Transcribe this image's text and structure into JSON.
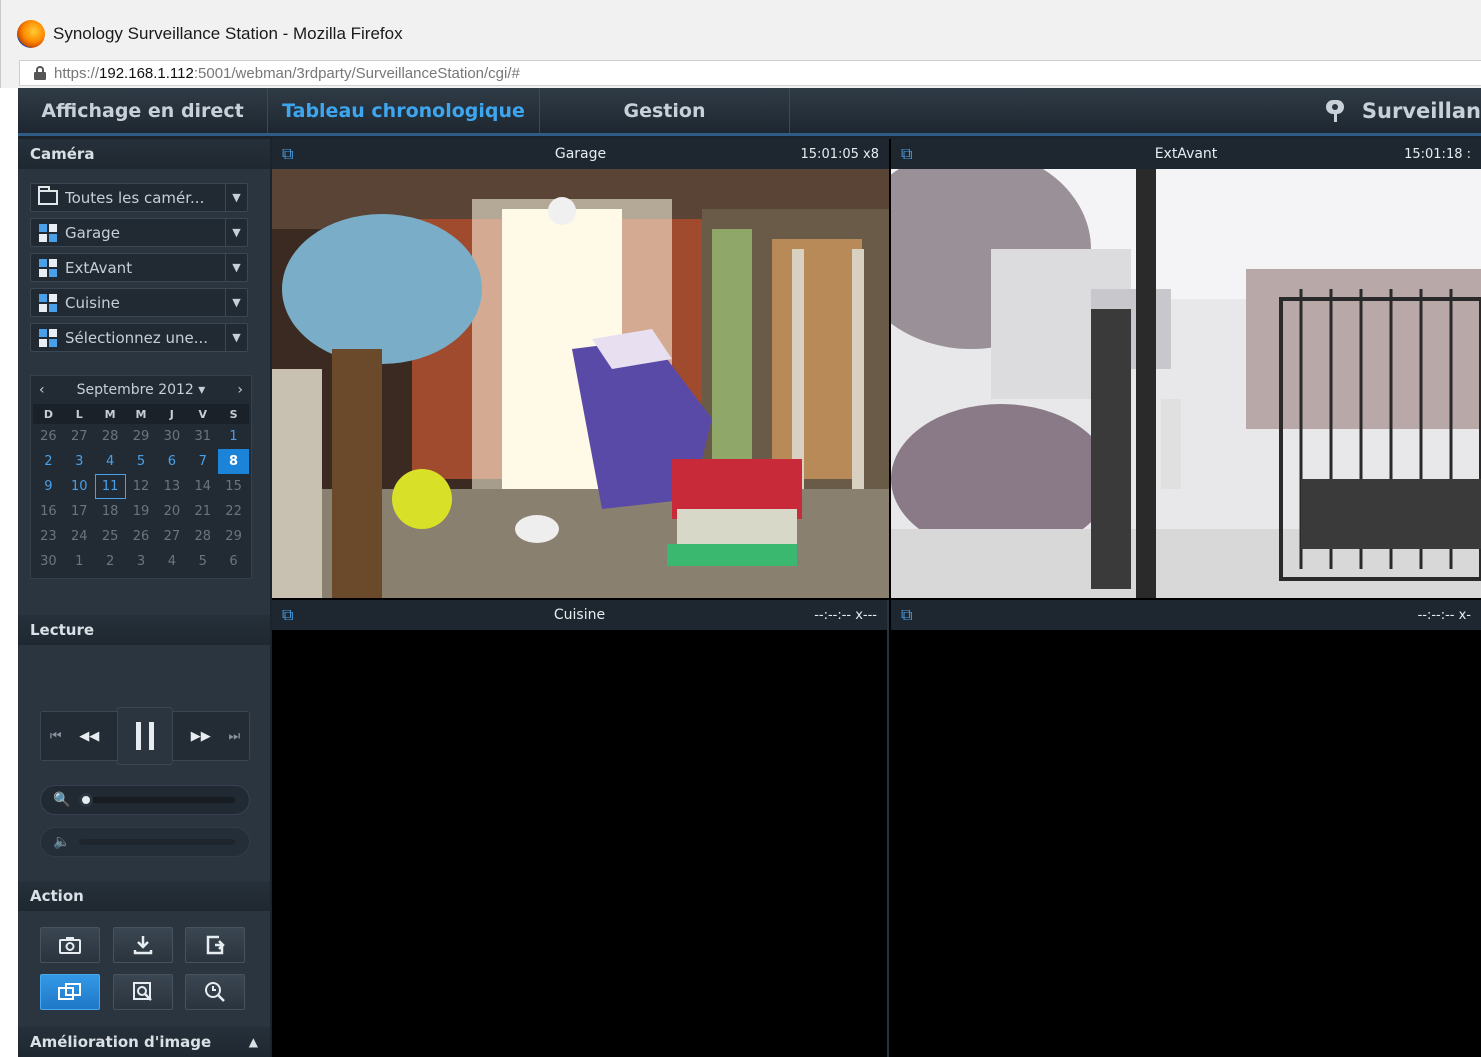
{
  "browser": {
    "window_title": "Synology Surveillance Station - Mozilla Firefox",
    "url_prefix": "https://",
    "url_host": "192.168.1.112",
    "url_rest": ":5001/webman/3rdparty/SurveillanceStation/cgi/#"
  },
  "nav": {
    "tabs": [
      "Affichage en direct",
      "Tableau chronologique",
      "Gestion"
    ],
    "active_tab": "Tableau chronologique",
    "brand": "Surveillan"
  },
  "sidebar": {
    "camera_header": "Caméra",
    "camera_items": [
      {
        "label": "Toutes les camér...",
        "icon": "folder-icon"
      },
      {
        "label": "Garage",
        "icon": "grid-icon"
      },
      {
        "label": "ExtAvant",
        "icon": "grid-icon"
      },
      {
        "label": "Cuisine",
        "icon": "grid-icon"
      },
      {
        "label": "Sélectionnez une...",
        "icon": "grid-icon"
      }
    ],
    "calendar": {
      "month_label": "Septembre 2012",
      "prev": "‹",
      "next": "›",
      "dropdown": "▾",
      "weekdays": [
        "D",
        "L",
        "M",
        "M",
        "J",
        "V",
        "S"
      ],
      "weeks": [
        [
          "26",
          "27",
          "28",
          "29",
          "30",
          "31",
          "1"
        ],
        [
          "2",
          "3",
          "4",
          "5",
          "6",
          "7",
          "8"
        ],
        [
          "9",
          "10",
          "11",
          "12",
          "13",
          "14",
          "15"
        ],
        [
          "16",
          "17",
          "18",
          "19",
          "20",
          "21",
          "22"
        ],
        [
          "23",
          "24",
          "25",
          "26",
          "27",
          "28",
          "29"
        ],
        [
          "30",
          "1",
          "2",
          "3",
          "4",
          "5",
          "6"
        ]
      ],
      "selected_day": "8",
      "today_day": "11"
    },
    "playback_header": "Lecture",
    "playback_buttons": [
      "⏮",
      "◀◀",
      "▶▶",
      "⏭"
    ],
    "zoom_icon": "🔍",
    "volume_icon": "🔈",
    "zoom_level": 0,
    "volume_level": 0,
    "action_header": "Action",
    "action_buttons": [
      "camera-icon",
      "download-icon",
      "export-icon",
      "layout-icon",
      "search-frame-icon",
      "zoom-clock-icon"
    ],
    "enhance_header": "Amélioration d'image",
    "enhance_toggle": "▲"
  },
  "panes": [
    {
      "name": "Garage",
      "time": "15:01:05 x8",
      "selected": true
    },
    {
      "name": "ExtAvant",
      "time": "15:01:18 :",
      "selected": false
    },
    {
      "name": "Cuisine",
      "time": "--:--:-- x---",
      "selected": false
    },
    {
      "name": "",
      "time": "--:--:-- x-",
      "selected": false
    }
  ],
  "colors": {
    "accent": "#3ea6ef",
    "selected_frame": "#d6a93a",
    "calendar_selected": "#1c84d8"
  }
}
